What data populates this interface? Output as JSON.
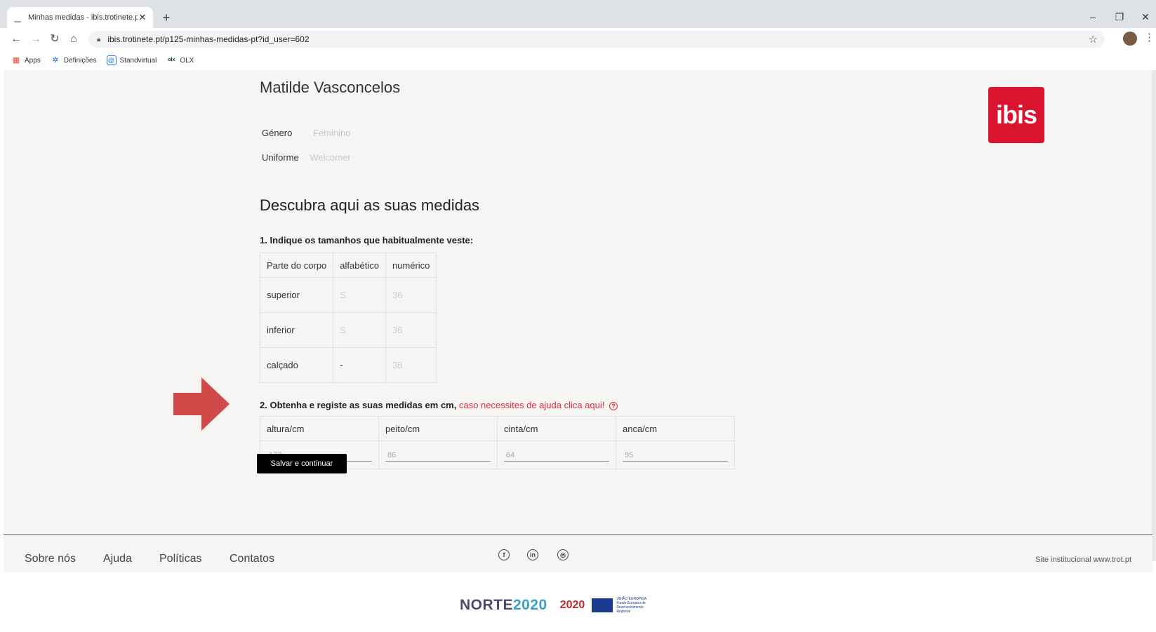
{
  "browser": {
    "tab_title": "Minhas medidas - ibis.trotinete.p",
    "new_tab": "+",
    "url": "ibis.trotinete.pt/p125-minhas-medidas-pt?id_user=602",
    "bookmarks": [
      {
        "label": "Apps",
        "icon": "apps-grid-icon",
        "color": "#e94235"
      },
      {
        "label": "Definições",
        "icon": "gear-icon",
        "color": "#1a73e8"
      },
      {
        "label": "Standvirtual",
        "icon": "standvirtual-icon",
        "color": "#1a73e8"
      },
      {
        "label": "OLX",
        "icon": "olx-icon",
        "color": "#002f34"
      }
    ]
  },
  "profile": {
    "name": "Matilde Vasconcelos",
    "genero_label": "Género",
    "genero_value": "Feminino",
    "uniforme_label": "Uniforme",
    "uniforme_value": "Welcomer"
  },
  "logo_text": "ibis",
  "section_title": "Descubra aqui as suas medidas",
  "step1": {
    "title": "1. Indique os tamanhos que habitualmente veste:",
    "headers": [
      "Parte do corpo",
      "alfabético",
      "numérico"
    ],
    "rows": [
      {
        "part": "superior",
        "alpha": "S",
        "num": "36"
      },
      {
        "part": "inferior",
        "alpha": "S",
        "num": "36"
      },
      {
        "part": "calçado",
        "alpha": "-",
        "num": "38"
      }
    ]
  },
  "step2": {
    "title": "2. Obtenha e registe as suas medidas em cm,",
    "help_link": "caso necessites de ajuda clica aqui!",
    "help_icon": "?",
    "fields": [
      {
        "label": "altura/cm",
        "placeholder": "172"
      },
      {
        "label": "peito/cm",
        "placeholder": "86"
      },
      {
        "label": "cinta/cm",
        "placeholder": "64"
      },
      {
        "label": "anca/cm",
        "placeholder": "95"
      }
    ]
  },
  "save_button": "Salvar e continuar",
  "footer": {
    "links": [
      "Sobre nós",
      "Ajuda",
      "Políticas",
      "Contatos"
    ],
    "social": [
      {
        "icon": "facebook-icon",
        "glyph": "f"
      },
      {
        "icon": "linkedin-icon",
        "glyph": "in"
      },
      {
        "icon": "instagram-icon",
        "glyph": "◎"
      }
    ],
    "site_text": "Site institucional www.trot.pt"
  },
  "funding": {
    "norte_a": "NORTE",
    "norte_b": "2020",
    "portugal": "2020",
    "eu_text": "UNIÃO EUROPEIA Fundo Europeu de Desenvolvimento Regional"
  },
  "colors": {
    "accent_red": "#e12d3a",
    "logo_red": "#d9142e",
    "arrow_red": "#d04a4a"
  }
}
